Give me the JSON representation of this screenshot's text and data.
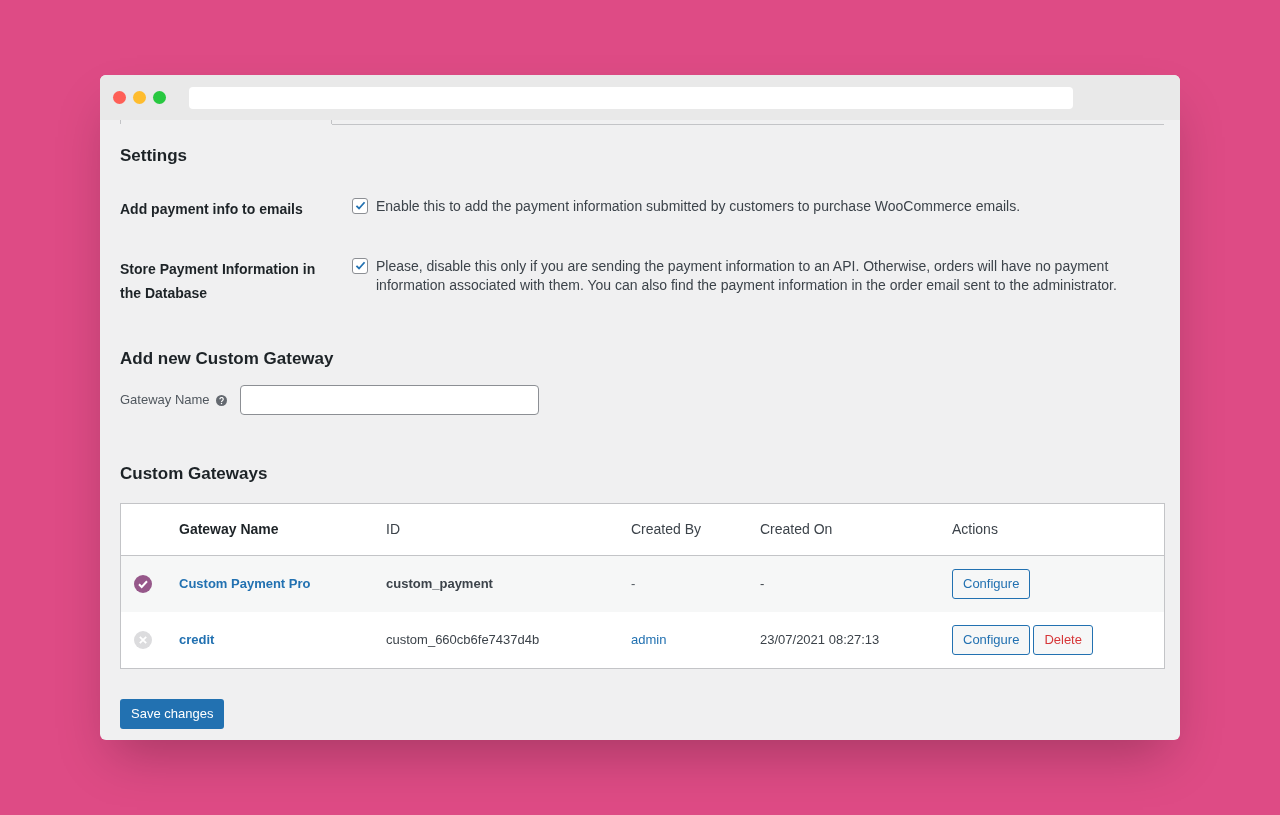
{
  "sections": [
    {
      "title": "Settings"
    }
  ],
  "settings": [
    {
      "label": "Add payment info to emails",
      "checked": true,
      "description": "Enable this to add the payment information submitted by customers to purchase WooCommerce emails."
    },
    {
      "label": "Store Payment Information in the Database",
      "checked": true,
      "description": "Please, disable this only if you are sending the payment information to an API. Otherwise, orders will have no payment information associated with them. You can also find the payment information in the order email sent to the administrator."
    }
  ],
  "add_gateway": {
    "title": "Add new Custom Gateway",
    "field_label": "Gateway Name"
  },
  "table": {
    "title": "Custom Gateways",
    "columns": [
      "Gateway Name",
      "ID",
      "Created By",
      "Created On",
      "Actions"
    ],
    "rows": [
      {
        "enabled": true,
        "default": true,
        "name": "Custom Payment Pro",
        "id": "custom_payment",
        "created_by": {
          "text": "-",
          "link": false
        },
        "created_on": "-",
        "actions": [
          {
            "kind": "configure",
            "label": "Configure"
          }
        ]
      },
      {
        "enabled": false,
        "default": false,
        "name": "credit",
        "id": "custom_660cb6fe7437d4b",
        "created_by": {
          "text": "admin",
          "link": true
        },
        "created_on": "23/07/2021 08:27:13",
        "actions": [
          {
            "kind": "configure",
            "label": "Configure"
          },
          {
            "kind": "delete",
            "label": "Delete"
          }
        ]
      }
    ]
  },
  "save_button": "Save changes"
}
